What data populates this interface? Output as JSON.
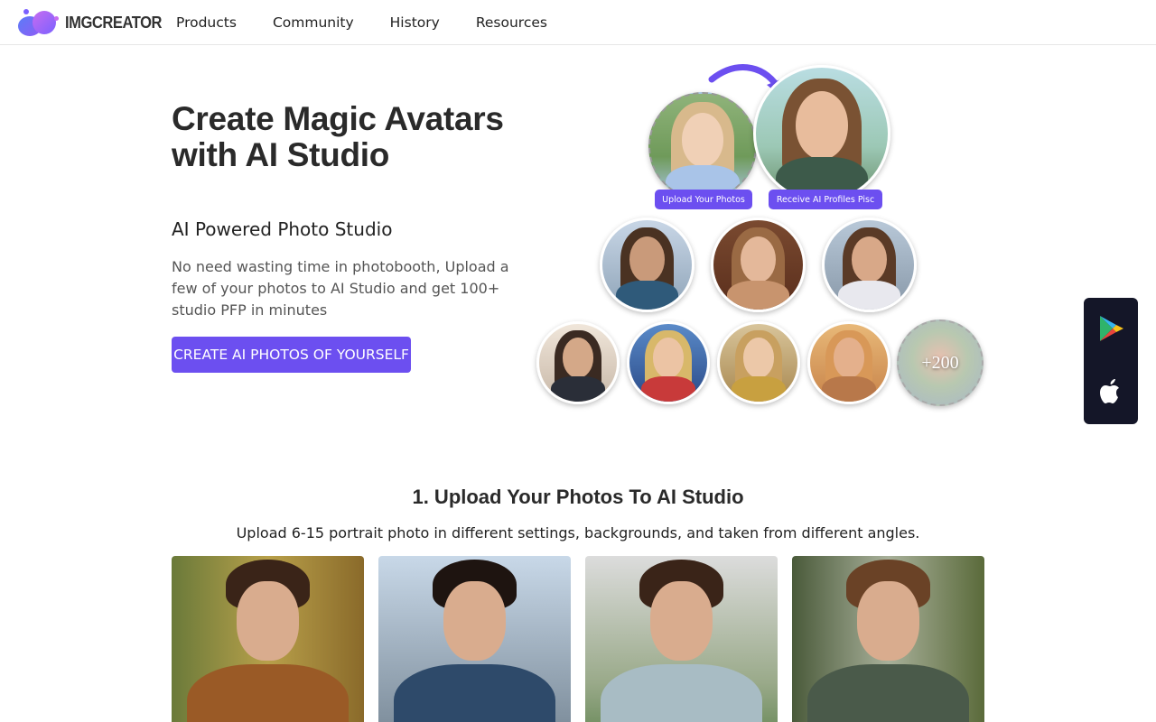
{
  "brand": {
    "name": "IMGCREATOR"
  },
  "nav": {
    "items": [
      "Products",
      "Community",
      "History",
      "Resources"
    ]
  },
  "hero": {
    "title": "Create Magic Avatars with AI Studio",
    "subtitle": "AI Powered Photo Studio",
    "description": "No need wasting time in photobooth, Upload a few of your photos to AI Studio and get 100+ studio PFP in minutes",
    "cta_label": "CREATE AI PHOTOS OF YOURSELF"
  },
  "collage": {
    "upload_label": "Upload Your Photos",
    "receive_label": "Receive AI Profiles Pisc",
    "more_count": "+200"
  },
  "store_panel": {
    "icons": [
      "google-play-icon",
      "apple-icon"
    ]
  },
  "section_upload": {
    "title": "1. Upload Your Photos To AI Studio",
    "description": "Upload 6-15 portrait photo in different settings, backgrounds, and taken from different angles."
  },
  "colors": {
    "accent": "#6c4ff0",
    "panel": "#141628"
  }
}
